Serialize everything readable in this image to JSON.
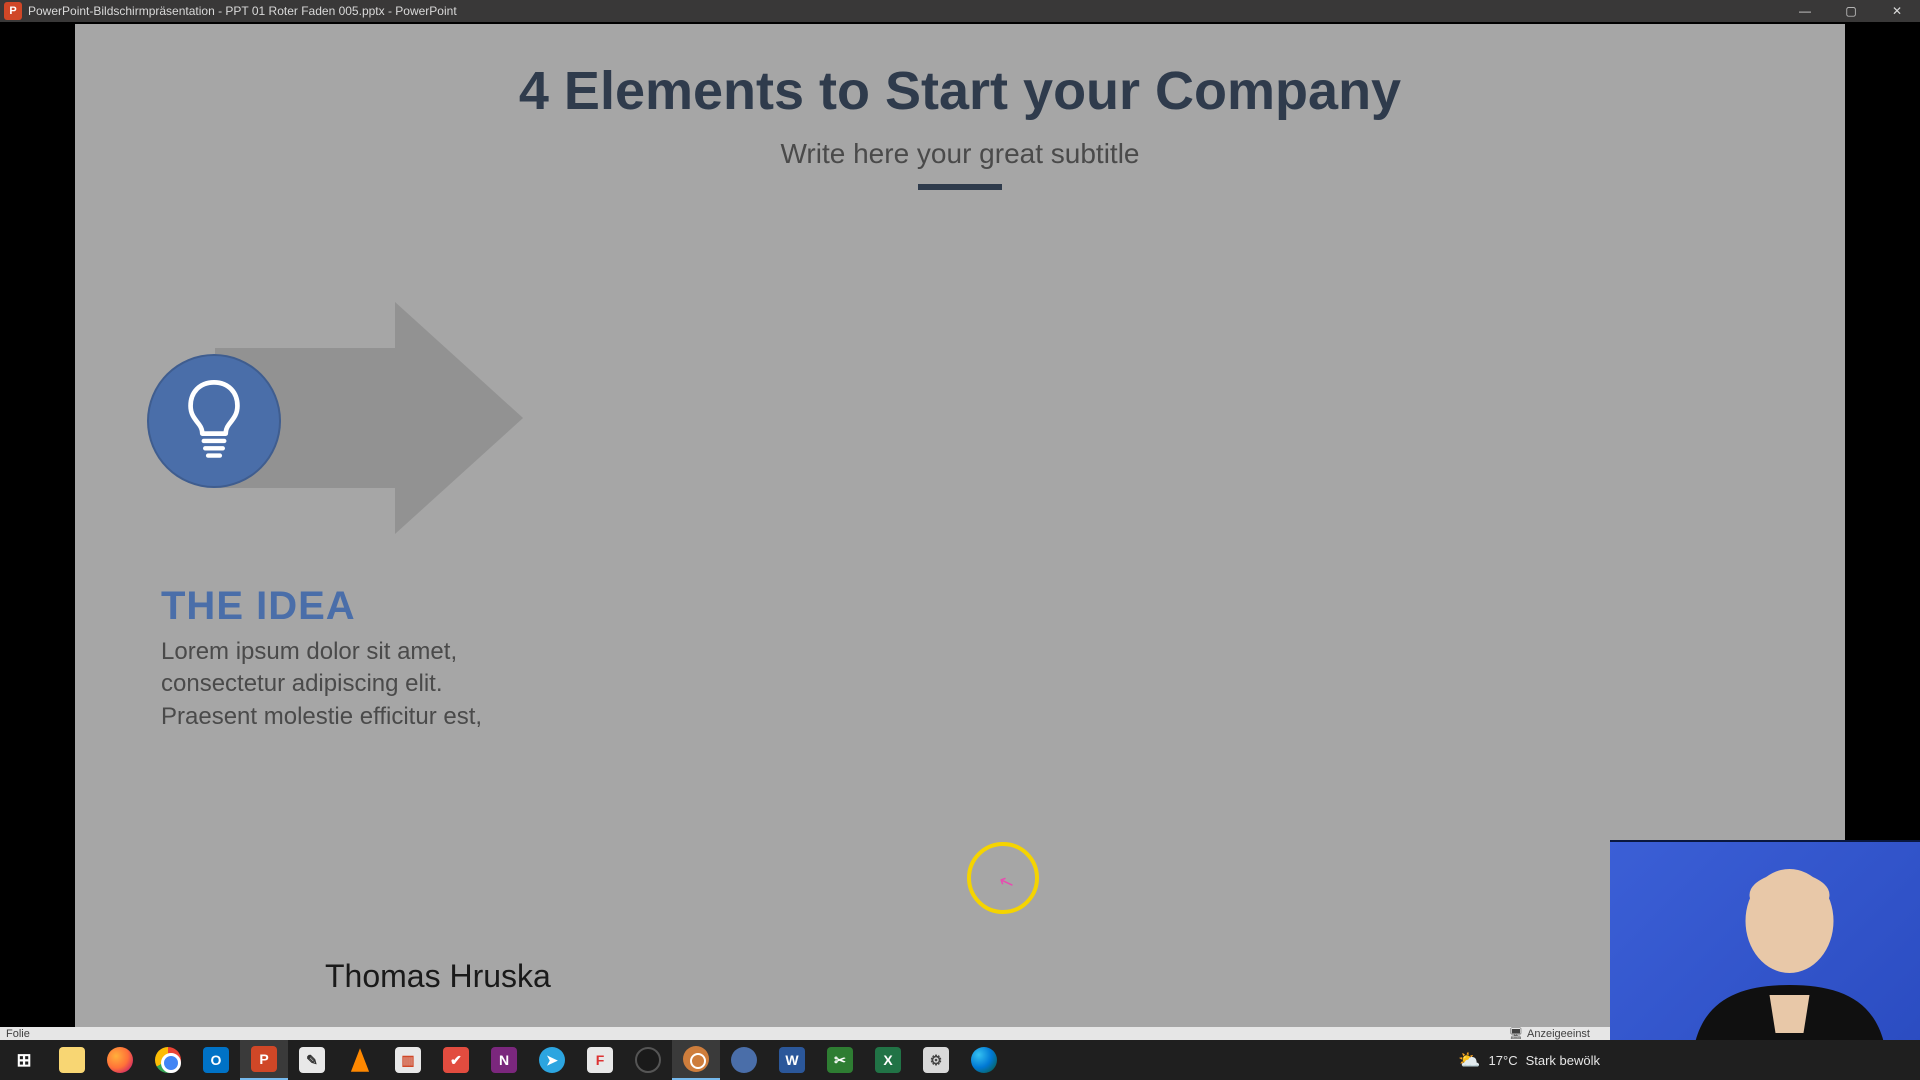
{
  "titlebar": {
    "app_initial": "P",
    "text": "PowerPoint-Bildschirmpräsentation  -  PPT 01 Roter Faden 005.pptx - PowerPoint",
    "min": "—",
    "max": "▢",
    "close": "✕"
  },
  "slide": {
    "title": "4 Elements to Start your Company",
    "subtitle": "Write here your great subtitle",
    "idea_heading": "THE IDEA",
    "idea_body": "Lorem ipsum dolor sit amet, consectetur adipiscing elit. Praesent molestie efficitur est,",
    "presenter": "Thomas Hruska"
  },
  "statusbar": {
    "left": "Folie",
    "right_icon": "🖥",
    "right_text": "Anzeigeeinst"
  },
  "tray": {
    "weather_icon": "⛅",
    "temp": "17°C",
    "weather_text": "Stark bewölk"
  },
  "taskbar": {
    "start": "⊞",
    "outlook": "O",
    "ppt": "P",
    "paint": "✎",
    "gen1": "▥",
    "todo": "✔",
    "onenote": "N",
    "tg": "➤",
    "fox": "F",
    "word": "W",
    "snip": "✂",
    "excel": "X",
    "tool": "⚙"
  }
}
